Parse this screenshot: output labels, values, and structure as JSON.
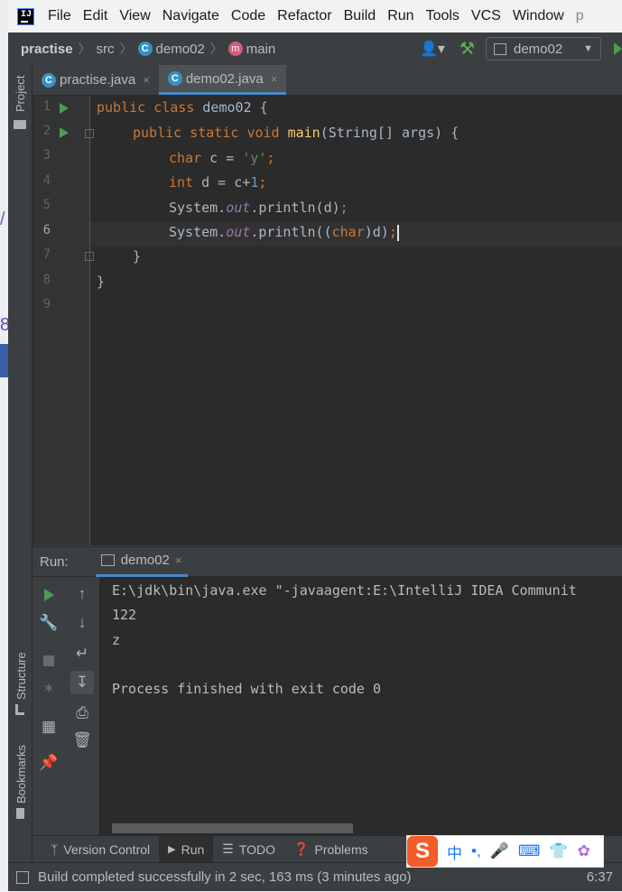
{
  "menu": [
    "File",
    "Edit",
    "View",
    "Navigate",
    "Code",
    "Refactor",
    "Build",
    "Run",
    "Tools",
    "VCS",
    "Window",
    "p"
  ],
  "breadcrumb": {
    "project": "practise",
    "folder": "src",
    "class_name": "demo02",
    "method": "main"
  },
  "run_config": "demo02",
  "side_labels": {
    "project": "Project",
    "structure": "Structure",
    "bookmarks": "Bookmarks"
  },
  "tabs": [
    {
      "label": "practise.java",
      "close": "×"
    },
    {
      "label": "demo02.java",
      "close": "×"
    }
  ],
  "line_numbers": [
    "1",
    "2",
    "3",
    "4",
    "5",
    "6",
    "7",
    "8",
    "9"
  ],
  "code": {
    "l1": {
      "public": "public",
      "class": "class",
      "rest": " demo02 {"
    },
    "l2": {
      "public": "public",
      "static": "static",
      "void": "void",
      "main": "main",
      "rest": "(String[] args) {"
    },
    "l3": {
      "type": "char",
      "mid": " c = ",
      "str": "'y'",
      "semi": ";"
    },
    "l4": {
      "type": "int",
      "mid": " d = c+",
      "num": "1",
      "semi": ";"
    },
    "l5": {
      "obj": "System.",
      "fld": "out",
      "call": ".println(d)",
      "semi": ";"
    },
    "l6": {
      "obj": "System.",
      "fld": "out",
      "call1": ".println((",
      "kw": "char",
      "call2": ")d)",
      "semi": ";"
    },
    "l7": "}",
    "l8": "}"
  },
  "run_panel": {
    "label": "Run:",
    "tab": "demo02",
    "close": "×"
  },
  "console": [
    "E:\\jdk\\bin\\java.exe \"-javaagent:E:\\IntelliJ IDEA Communit",
    "122",
    "z",
    "",
    "Process finished with exit code 0"
  ],
  "bottom_tabs": [
    {
      "label": "Version Control",
      "icon": "branch-icon"
    },
    {
      "label": "Run",
      "icon": "play-icon"
    },
    {
      "label": "TODO",
      "icon": "list-icon"
    },
    {
      "label": "Problems",
      "icon": "info-icon"
    }
  ],
  "status": "Build completed successfully in 2 sec, 163 ms (3 minutes ago)",
  "time": "6:37",
  "ime": {
    "logo": "S",
    "lang": "中",
    "punct": "•,"
  },
  "colors": {
    "keyword": "#cc7832",
    "function": "#ffc66d",
    "string": "#6a8759",
    "number": "#6897bb",
    "field": "#9876aa",
    "run_green": "#499c54",
    "accent": "#4a88c7"
  }
}
